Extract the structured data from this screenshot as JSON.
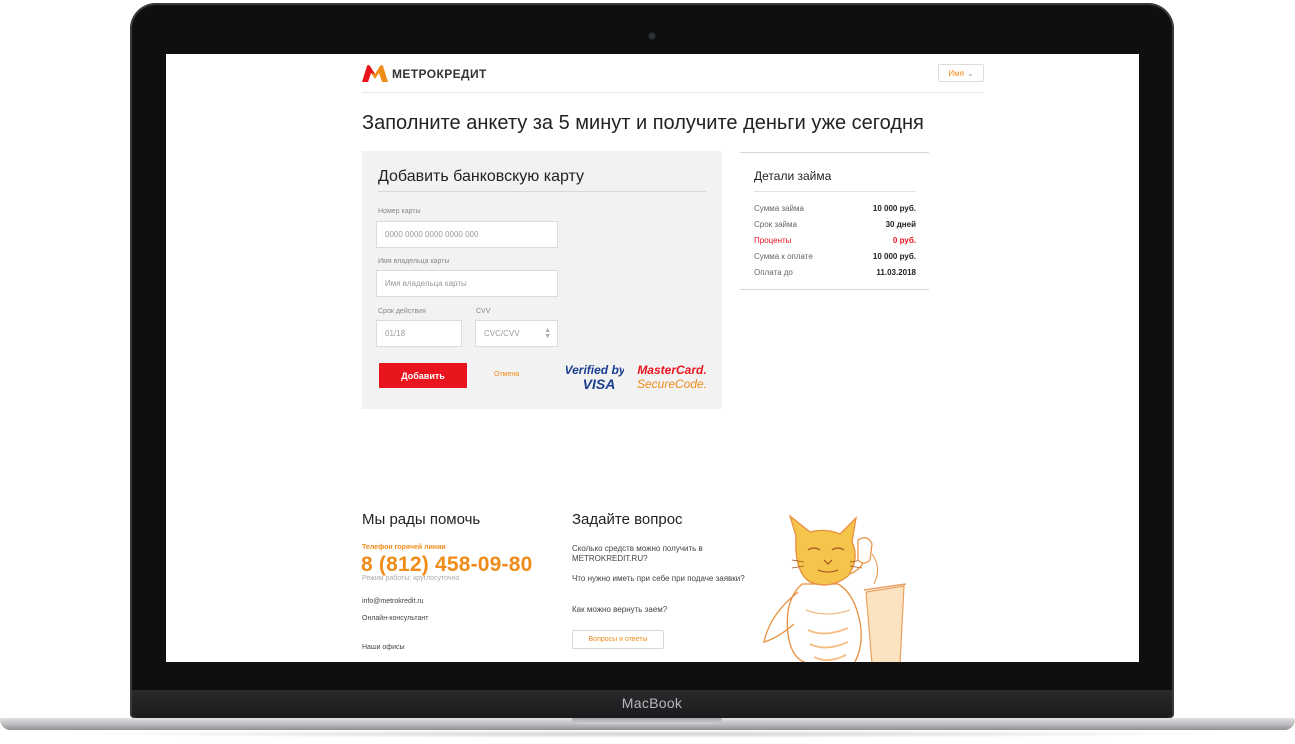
{
  "device": {
    "label": "MacBook"
  },
  "header": {
    "brand": "МЕТРОКРЕДИТ",
    "user_button": "Имя"
  },
  "headline": "Заполните анкету за 5 минут и получите деньги уже сегодня",
  "card_form": {
    "title": "Добавить банковскую карту",
    "card_number_label": "Номер карты",
    "card_number_placeholder": "0000 0000 0000 0000 000",
    "holder_label": "Имя владельца карты",
    "holder_placeholder": "Имя владельца карты",
    "expiry_label": "Срок действия",
    "expiry_placeholder": "01/18",
    "cvv_label": "CVV",
    "cvv_placeholder": "CVC/CVV",
    "submit_label": "Добавить",
    "cancel_label": "Отмена",
    "visa_line1": "Verified by",
    "visa_line2": "VISA",
    "mc_line1": "MasterCard.",
    "mc_line2": "SecureCode."
  },
  "loan": {
    "title": "Детали займа",
    "rows": [
      {
        "label": "Сумма займа",
        "value": "10 000 руб."
      },
      {
        "label": "Срок займа",
        "value": "30 дней"
      },
      {
        "label": "Проценты",
        "value": "0 руб."
      },
      {
        "label": "Сумма к оплате",
        "value": "10 000 руб."
      },
      {
        "label": "Оплата до",
        "value": "11.03.2018"
      }
    ]
  },
  "help": {
    "title": "Мы рады помочь",
    "hotline_label": "Телефон горячей линии",
    "phone": "8 (812) 458-09-80",
    "hours": "Режим работы: круглосуточно",
    "email": "info@metrokredit.ru",
    "consultant": "Онлайн-консультант",
    "offices": "Наши офисы"
  },
  "faq": {
    "title": "Задайте вопрос",
    "q1": "Сколько средств можно получить в METROKREDIT.RU?",
    "q2": "Что нужно иметь при себе при подаче заявки?",
    "q3": "Как можно вернуть заем?",
    "button": "Вопросы и ответы"
  },
  "colors": {
    "accent_red": "#e8141e",
    "accent_orange": "#f08c1a",
    "panel_bg": "#f2f2f2"
  },
  "icons": [
    "metrokredit-logo-icon",
    "chevron-down-icon",
    "spinner-arrows-icon",
    "verified-by-visa-logo",
    "mastercard-securecode-logo",
    "cat-mascot-illustration"
  ]
}
